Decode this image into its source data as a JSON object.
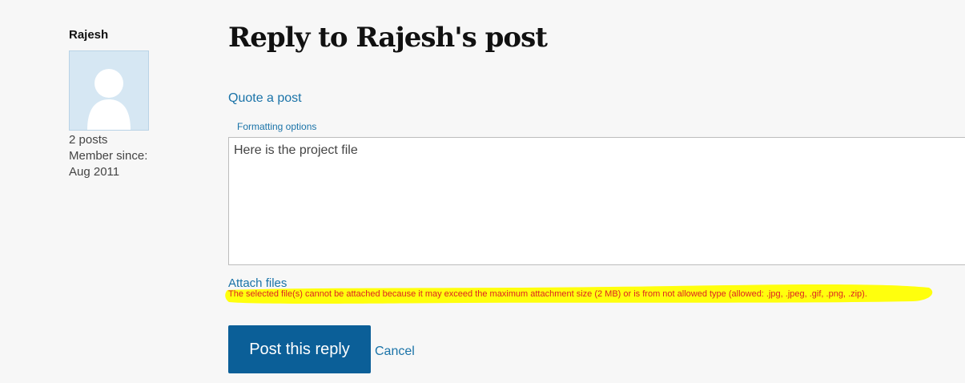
{
  "author": {
    "name": "Rajesh",
    "post_count": "2 posts",
    "member_since_label": "Member since:",
    "member_since_date": "Aug 2011",
    "avatar_icon": "default-user-avatar-icon"
  },
  "page": {
    "title": "Reply to Rajesh's post"
  },
  "reply_form": {
    "quote_link": "Quote a post",
    "formatting_link": "Formatting options",
    "body_value": "Here is the project file",
    "attach_link": "Attach files",
    "error_message": "The selected file(s) cannot be attached because it may exceed the maximum attachment size (2 MB) or is from not allowed type (allowed: .jpg, .jpeg, .gif, .png, .zip).",
    "submit_label": "Post this reply",
    "cancel_label": "Cancel"
  },
  "colors": {
    "link": "#1a73a8",
    "primary_button": "#0b5f98",
    "error": "#dd2222",
    "highlight": "#ffff00"
  }
}
